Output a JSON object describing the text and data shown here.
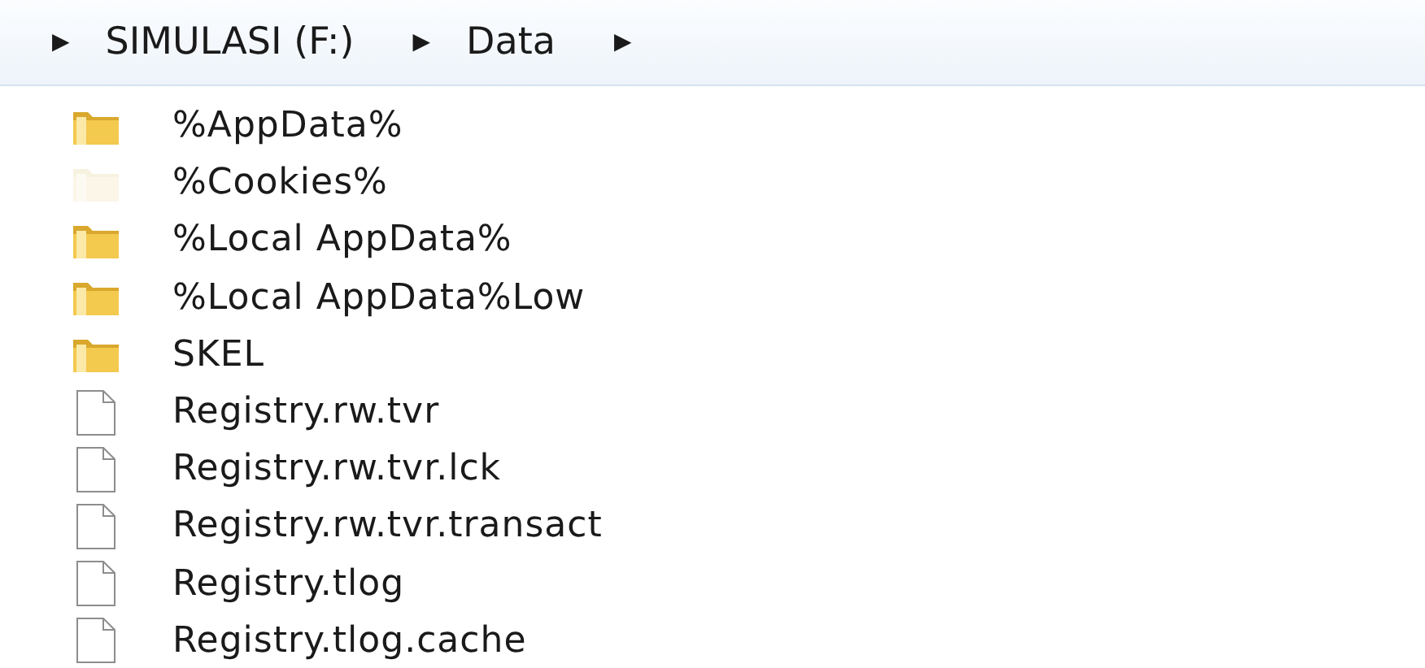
{
  "address_bar": {
    "crumbs": [
      {
        "arrow": "▶",
        "label": "SIMULASI (F:)"
      },
      {
        "arrow": "▶",
        "label": "Data"
      }
    ],
    "trailing_arrow": "▶"
  },
  "files": [
    {
      "name": "%AppData%",
      "kind": "folder",
      "hidden": false
    },
    {
      "name": "%Cookies%",
      "kind": "folder",
      "hidden": true
    },
    {
      "name": "%Local AppData%",
      "kind": "folder",
      "hidden": false
    },
    {
      "name": "%Local AppData%Low",
      "kind": "folder",
      "hidden": false
    },
    {
      "name": "SKEL",
      "kind": "folder",
      "hidden": false
    },
    {
      "name": "Registry.rw.tvr",
      "kind": "file"
    },
    {
      "name": "Registry.rw.tvr.lck",
      "kind": "file"
    },
    {
      "name": "Registry.rw.tvr.transact",
      "kind": "file"
    },
    {
      "name": "Registry.tlog",
      "kind": "file"
    },
    {
      "name": "Registry.tlog.cache",
      "kind": "file"
    }
  ]
}
